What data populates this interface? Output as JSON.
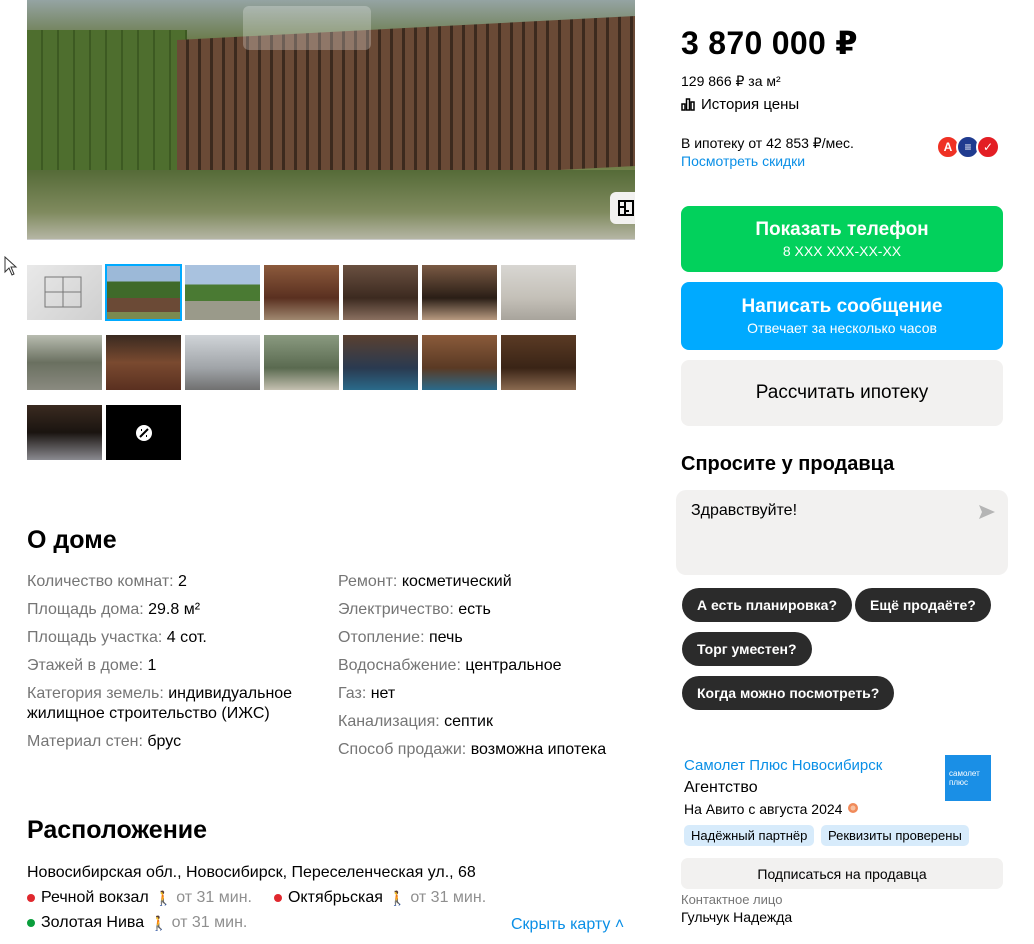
{
  "price": {
    "value": "3 870 000 ₽",
    "per_meter": "129 866 ₽ за м²",
    "history_label": "История цены"
  },
  "mortgage": {
    "text": "В ипотеку от 42 853 ₽/мес.",
    "discounts_link": "Посмотреть скидки"
  },
  "banks": [
    {
      "letter": "А",
      "color": "#ef3124",
      "icon": "alfa-bank-icon"
    },
    {
      "letter": "≡",
      "color": "#1f3b8f",
      "icon": "bank-icon"
    },
    {
      "letter": "✓",
      "color": "#e31e24",
      "icon": "bank-icon"
    }
  ],
  "buttons": {
    "phone_main": "Показать телефон",
    "phone_sub": "8 XXX XXX-XX-XX",
    "message_main": "Написать сообщение",
    "message_sub": "Отвечает за несколько часов",
    "calc": "Рассчитать ипотеку"
  },
  "ask": {
    "title": "Спросите у продавца",
    "input_value": "Здравствуйте!",
    "chips": [
      "А есть планировка?",
      "Ещё продаёте?",
      "Торг уместен?",
      "Когда можно посмотреть?"
    ]
  },
  "seller": {
    "name": "Самолет Плюс Новосибирск",
    "type": "Агентство",
    "since": "На Авито с августа 2024",
    "logo_text": "самолет плюс",
    "badges": [
      "Надёжный партнёр",
      "Реквизиты проверены"
    ],
    "subscribe": "Подписаться на продавца",
    "contact_label": "Контактное лицо",
    "contact_name": "Гульчук Надежда"
  },
  "about": {
    "title": "О доме",
    "left": [
      {
        "k": "Количество комнат: ",
        "v": "2"
      },
      {
        "k": "Площадь дома: ",
        "v": "29.8 м²"
      },
      {
        "k": "Площадь участка: ",
        "v": "4 сот."
      },
      {
        "k": "Этажей в доме: ",
        "v": "1"
      },
      {
        "k": "Категория земель: ",
        "v": "индивидуальное жилищное строительство (ИЖС)"
      },
      {
        "k": "Материал стен: ",
        "v": "брус"
      }
    ],
    "right": [
      {
        "k": "Ремонт: ",
        "v": "косметический"
      },
      {
        "k": "Электричество: ",
        "v": "есть"
      },
      {
        "k": "Отопление: ",
        "v": "печь"
      },
      {
        "k": "Водоснабжение: ",
        "v": "центральное"
      },
      {
        "k": "Газ: ",
        "v": "нет"
      },
      {
        "k": "Канализация: ",
        "v": "септик"
      },
      {
        "k": "Способ продажи: ",
        "v": "возможна ипотека"
      }
    ]
  },
  "location": {
    "title": "Расположение",
    "address": "Новосибирская обл., Новосибирск, Переселенческая ул., 68",
    "metro": [
      {
        "name": "Речной вокзал",
        "time": "от 31 мин.",
        "color": "#e0282e"
      },
      {
        "name": "Октябрьская",
        "time": "от 31 мин.",
        "color": "#e0282e"
      },
      {
        "name": "Золотая Нива",
        "time": "от 31 мин.",
        "color": "#0a9e3c"
      }
    ],
    "hide_map": "Скрыть карту"
  },
  "colors": {
    "accent_green": "#02d15c",
    "accent_blue": "#00aaff",
    "link": "#0a8fe6"
  }
}
